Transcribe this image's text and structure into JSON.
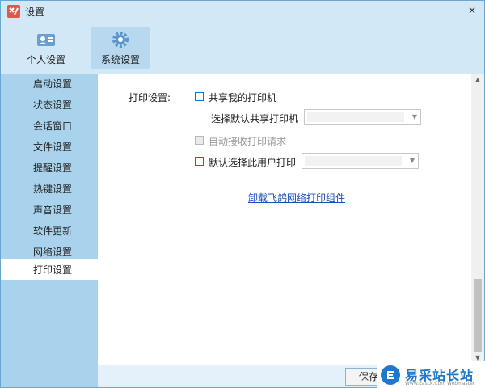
{
  "window": {
    "title": "设置",
    "min_glyph": "—",
    "close_glyph": "✕"
  },
  "toolbar": {
    "tabs": [
      {
        "label": "个人设置",
        "icon": "contact-card-icon",
        "active": false
      },
      {
        "label": "系统设置",
        "icon": "gear-icon",
        "active": true
      }
    ]
  },
  "sidebar": {
    "items": [
      {
        "label": "启动设置",
        "active": false
      },
      {
        "label": "状态设置",
        "active": false
      },
      {
        "label": "会话窗口",
        "active": false
      },
      {
        "label": "文件设置",
        "active": false
      },
      {
        "label": "提醒设置",
        "active": false
      },
      {
        "label": "热键设置",
        "active": false
      },
      {
        "label": "声音设置",
        "active": false
      },
      {
        "label": "软件更新",
        "active": false
      },
      {
        "label": "网络设置",
        "active": false
      },
      {
        "label": "打印设置",
        "active": true
      }
    ]
  },
  "print": {
    "section_label": "打印设置:",
    "share_printer": {
      "label": "共享我的打印机",
      "checked": false
    },
    "default_share_label": "选择默认共享打印机",
    "default_share_value": "",
    "auto_accept": {
      "label": "自动接收打印请求",
      "checked": false,
      "disabled": true
    },
    "default_user_print": {
      "label": "默认选择此用户打印",
      "checked": false
    },
    "default_user_value": "",
    "uninstall_link": "卸载飞鸽网络打印组件"
  },
  "footer": {
    "save_label": "保存"
  },
  "watermark": {
    "title": "易采站长站",
    "subtitle": "Www.Easck.Com  Webmaster"
  },
  "colors": {
    "window_bg": "#d3e8f7",
    "sidebar_bg": "#a9d2ec",
    "accent": "#1f6fbf",
    "link": "#1a4fb5"
  }
}
